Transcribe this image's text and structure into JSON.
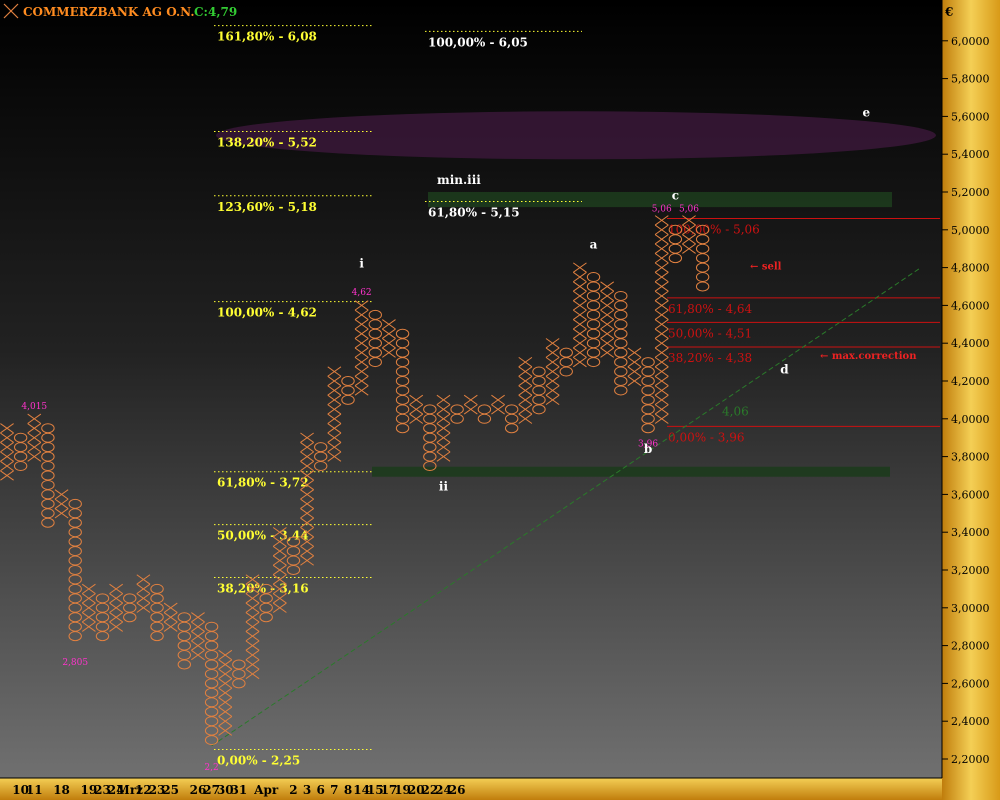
{
  "header": {
    "title": "COMMERZBANK AG O.N.",
    "last_label": "C:4,79",
    "currency": "€"
  },
  "colors": {
    "background_top": "#0a0a0a",
    "background_bottom": "#6a6a6a",
    "axis_gold_light": "#f6d25a",
    "axis_gold_dark": "#c88a10",
    "box_orange": "#e08040",
    "fib_yellow": "#ffff33",
    "fib_white": "#ffffff",
    "fib_red": "#cc1111",
    "label_magenta": "#ff33cc",
    "trend_green": "#2a7a2a",
    "zone_green": "#1d3b1d",
    "ellipse_purple": "#3a1838",
    "title_orange": "#ff8c20",
    "last_green": "#33cc33"
  },
  "chart_data": {
    "type": "point-and-figure",
    "title": "COMMERZBANK AG O.N.",
    "y_axis": {
      "ylim": [
        2.1,
        6.2
      ],
      "ticks": [
        2.2,
        2.4,
        2.6,
        2.8,
        3.0,
        3.2,
        3.4,
        3.6,
        3.8,
        4.0,
        4.2,
        4.4,
        4.6,
        4.8,
        5.0,
        5.2,
        5.4,
        5.6,
        5.8,
        6.0
      ],
      "tick_labels": [
        "2,2000",
        "2,4000",
        "2,6000",
        "2,8000",
        "3,0000",
        "3,2000",
        "3,4000",
        "3,6000",
        "3,8000",
        "4,0000",
        "4,2000",
        "4,4000",
        "4,6000",
        "4,8000",
        "5,0000",
        "5,2000",
        "5,4000",
        "5,6000",
        "5,8000",
        "6,0000"
      ]
    },
    "x_axis": {
      "tick_labels": [
        "10",
        "11",
        "18",
        "19",
        "23",
        "24",
        "Mrz",
        "12",
        "23",
        "25",
        "26",
        "27",
        "30",
        "31",
        "Apr",
        "2",
        "3",
        "6",
        "7",
        "8",
        "14",
        "15",
        "17",
        "19",
        "20",
        "22",
        "24",
        "26"
      ],
      "tick_columns": [
        1,
        2,
        4,
        6,
        7,
        8,
        9,
        10,
        11,
        12,
        14,
        15,
        16,
        17,
        19,
        21,
        22,
        23,
        24,
        25,
        26,
        27,
        28,
        29,
        30,
        31,
        32,
        33
      ]
    },
    "box_size": 0.05,
    "columns": [
      {
        "type": "X",
        "low": 3.7,
        "high": 3.95
      },
      {
        "type": "O",
        "low": 3.75,
        "high": 3.9
      },
      {
        "type": "X",
        "low": 3.8,
        "high": 4.0
      },
      {
        "type": "O",
        "low": 3.45,
        "high": 3.95
      },
      {
        "type": "X",
        "low": 3.5,
        "high": 3.6
      },
      {
        "type": "O",
        "low": 2.85,
        "high": 3.55
      },
      {
        "type": "X",
        "low": 2.9,
        "high": 3.1
      },
      {
        "type": "O",
        "low": 2.85,
        "high": 3.05
      },
      {
        "type": "X",
        "low": 2.9,
        "high": 3.1
      },
      {
        "type": "O",
        "low": 2.95,
        "high": 3.05
      },
      {
        "type": "X",
        "low": 3.0,
        "high": 3.15
      },
      {
        "type": "O",
        "low": 2.85,
        "high": 3.1
      },
      {
        "type": "X",
        "low": 2.9,
        "high": 3.0
      },
      {
        "type": "O",
        "low": 2.7,
        "high": 2.95
      },
      {
        "type": "X",
        "low": 2.75,
        "high": 2.95
      },
      {
        "type": "O",
        "low": 2.3,
        "high": 2.9
      },
      {
        "type": "X",
        "low": 2.35,
        "high": 2.75
      },
      {
        "type": "O",
        "low": 2.6,
        "high": 2.7
      },
      {
        "type": "X",
        "low": 2.65,
        "high": 3.15
      },
      {
        "type": "O",
        "low": 2.95,
        "high": 3.1
      },
      {
        "type": "X",
        "low": 3.0,
        "high": 3.4
      },
      {
        "type": "O",
        "low": 3.2,
        "high": 3.35
      },
      {
        "type": "X",
        "low": 3.25,
        "high": 3.9
      },
      {
        "type": "O",
        "low": 3.75,
        "high": 3.85
      },
      {
        "type": "X",
        "low": 3.8,
        "high": 4.25
      },
      {
        "type": "O",
        "low": 4.1,
        "high": 4.2
      },
      {
        "type": "X",
        "low": 4.15,
        "high": 4.6
      },
      {
        "type": "O",
        "low": 4.3,
        "high": 4.55
      },
      {
        "type": "X",
        "low": 4.35,
        "high": 4.5
      },
      {
        "type": "O",
        "low": 3.95,
        "high": 4.45
      },
      {
        "type": "X",
        "low": 4.0,
        "high": 4.1
      },
      {
        "type": "O",
        "low": 3.75,
        "high": 4.05
      },
      {
        "type": "X",
        "low": 3.8,
        "high": 4.1
      },
      {
        "type": "O",
        "low": 4.0,
        "high": 4.05
      },
      {
        "type": "X",
        "low": 4.05,
        "high": 4.1
      },
      {
        "type": "O",
        "low": 4.0,
        "high": 4.05
      },
      {
        "type": "X",
        "low": 4.05,
        "high": 4.1
      },
      {
        "type": "O",
        "low": 3.95,
        "high": 4.05
      },
      {
        "type": "X",
        "low": 4.0,
        "high": 4.3
      },
      {
        "type": "O",
        "low": 4.05,
        "high": 4.25
      },
      {
        "type": "X",
        "low": 4.1,
        "high": 4.4
      },
      {
        "type": "O",
        "low": 4.25,
        "high": 4.35
      },
      {
        "type": "X",
        "low": 4.3,
        "high": 4.8
      },
      {
        "type": "O",
        "low": 4.3,
        "high": 4.75
      },
      {
        "type": "X",
        "low": 4.35,
        "high": 4.7
      },
      {
        "type": "O",
        "low": 4.15,
        "high": 4.65
      },
      {
        "type": "X",
        "low": 4.2,
        "high": 4.35
      },
      {
        "type": "O",
        "low": 3.95,
        "high": 4.3
      },
      {
        "type": "X",
        "low": 4.0,
        "high": 5.05
      },
      {
        "type": "O",
        "low": 4.85,
        "high": 5.0
      },
      {
        "type": "X",
        "low": 4.9,
        "high": 5.05
      },
      {
        "type": "O",
        "low": 4.7,
        "high": 5.0
      }
    ],
    "value_labels": [
      {
        "text": "4,015",
        "col": 2,
        "value": 4.015
      },
      {
        "text": "2,805",
        "col": 5,
        "value": 2.805
      },
      {
        "text": "2,2",
        "col": 15,
        "value": 2.25
      },
      {
        "text": "4,62",
        "col": 26,
        "value": 4.62
      },
      {
        "text": "3,96",
        "col": 47,
        "value": 3.96
      },
      {
        "text": "5,06",
        "col": 48,
        "value": 5.06
      },
      {
        "text": "5,06",
        "col": 50,
        "value": 5.06
      }
    ],
    "fib_yellow": [
      {
        "text": "161,80% - 6,08",
        "value": 6.08
      },
      {
        "text": "138,20% - 5,52",
        "value": 5.52
      },
      {
        "text": "123,60% - 5,18",
        "value": 5.18
      },
      {
        "text": "100,00% - 4,62",
        "value": 4.62
      },
      {
        "text": "61,80% - 3,72",
        "value": 3.72
      },
      {
        "text": "50,00% - 3,44",
        "value": 3.44
      },
      {
        "text": "38,20% - 3,16",
        "value": 3.16
      },
      {
        "text": "0,00% - 2,25",
        "value": 2.25
      }
    ],
    "fib_white": [
      {
        "text": "100,00% - 6,05",
        "value": 6.05
      },
      {
        "text": "61,80% - 5,15",
        "value": 5.15
      }
    ],
    "fib_red": [
      {
        "text": "100,00% - 5,06",
        "value": 5.06
      },
      {
        "text": "61,80% - 4,64",
        "value": 4.64
      },
      {
        "text": "50,00% - 4,51",
        "value": 4.51
      },
      {
        "text": "38,20% - 4,38",
        "value": 4.38
      },
      {
        "text": "0,00% - 3,96",
        "value": 3.96
      }
    ],
    "wave_labels": [
      {
        "text": "i",
        "col": 26,
        "value": 4.8
      },
      {
        "text": "ii",
        "col": 32,
        "value": 3.62
      },
      {
        "text": "a",
        "col": 43,
        "value": 4.9
      },
      {
        "text": "b",
        "col": 47,
        "value": 3.82
      },
      {
        "text": "c",
        "col": 49,
        "value": 5.16
      },
      {
        "text": "d",
        "col": 57,
        "value": 4.24
      },
      {
        "text": "e",
        "col": 63,
        "value": 5.6
      }
    ],
    "annotations": {
      "min_iii": "min.iii",
      "sell": "← sell",
      "max_correction": "← max.correction",
      "support_value": "4,06"
    },
    "trendline": {
      "from": {
        "col": 15,
        "value": 2.27
      },
      "to": {
        "col": 67,
        "value": 4.8
      }
    },
    "zones": {
      "support": {
        "value": 3.72
      },
      "min_iii_box": {
        "low": 5.12,
        "high": 5.2
      },
      "target_ellipse": {
        "value": 5.5
      }
    }
  }
}
